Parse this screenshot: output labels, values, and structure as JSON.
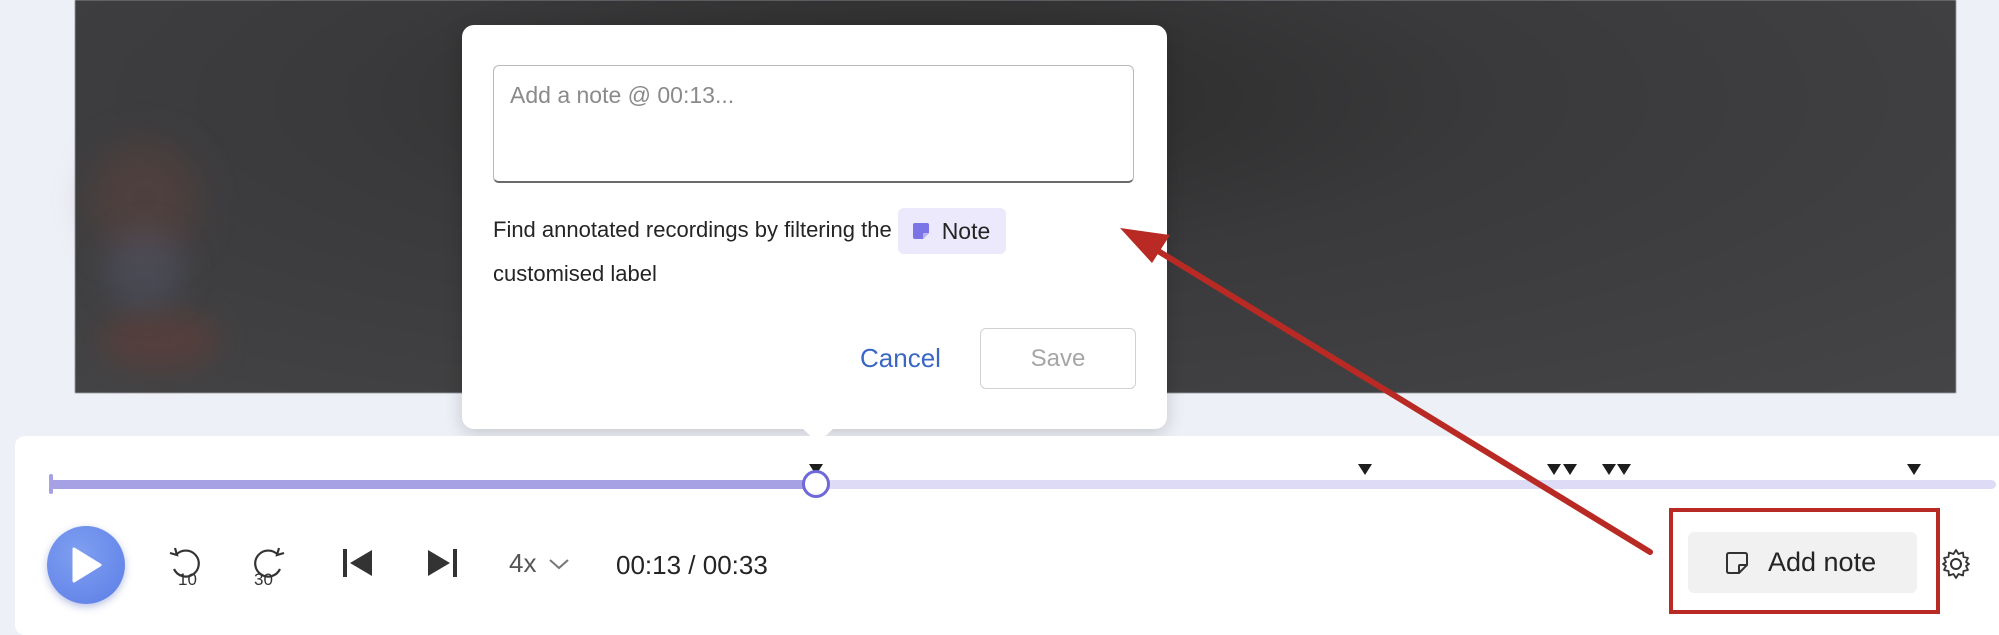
{
  "note_popover": {
    "input_placeholder": "Add a note @ 00:13...",
    "hint_text": "Find annotated recordings by filtering the",
    "hint_tail": "customised label",
    "chip_label": "Note",
    "cancel_label": "Cancel",
    "save_label": "Save"
  },
  "player": {
    "skip_back_label": "10",
    "skip_forward_label": "30",
    "speed": "4x",
    "time": "00:13 / 00:33",
    "progress": 0.394,
    "note_markers": [
      0.394,
      0.676,
      0.773,
      0.781,
      0.801,
      0.809,
      0.958
    ],
    "add_note_label": "Add note"
  },
  "colors": {
    "accent": "#6e68d8",
    "highlight_box": "#b82a23",
    "link": "#3a66c4"
  }
}
